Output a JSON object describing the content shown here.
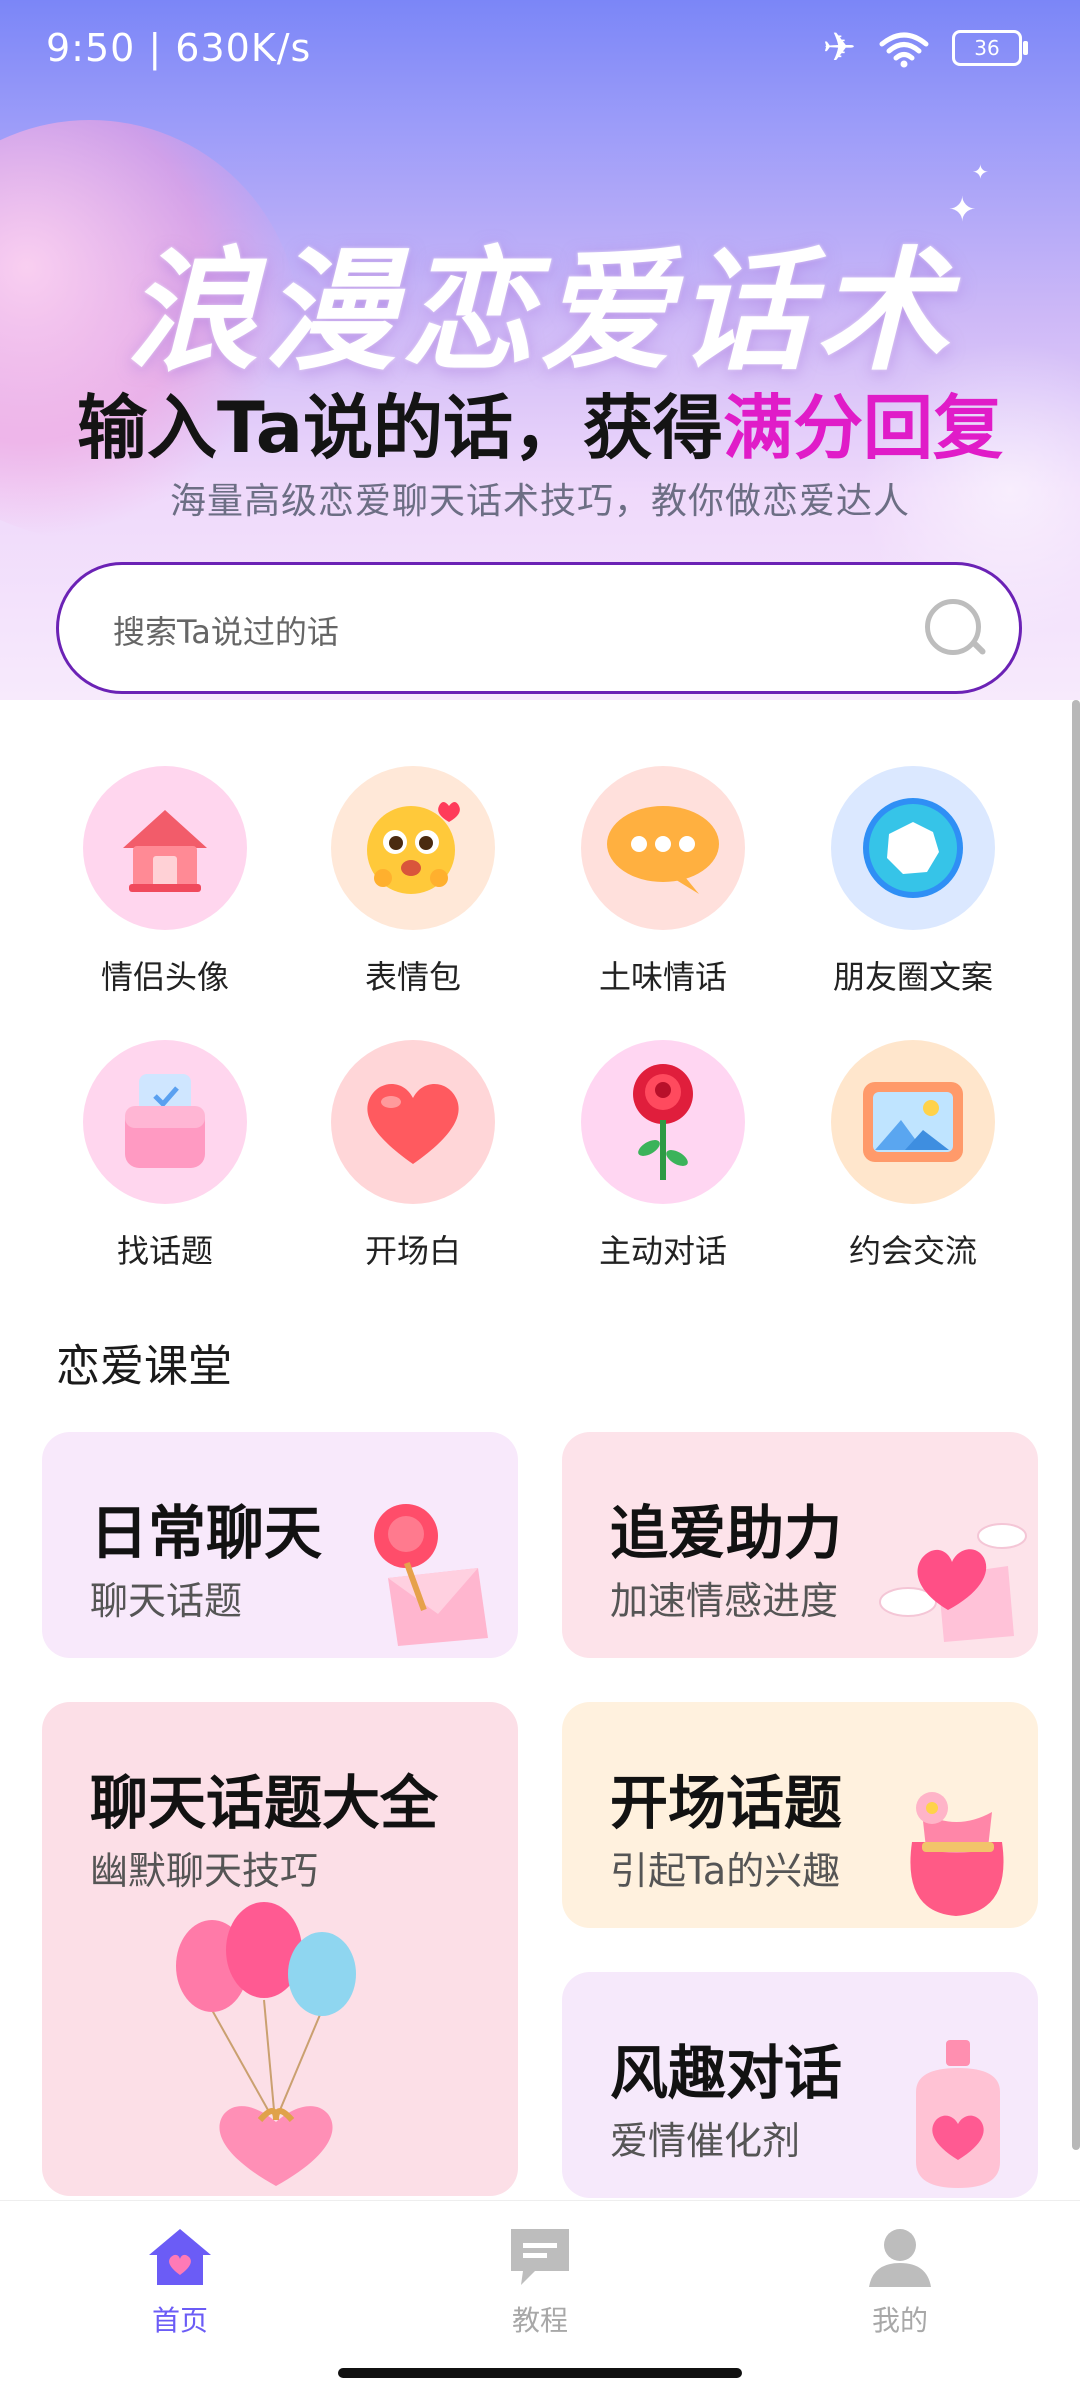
{
  "status_bar": {
    "time": "9:50 | 630K/s",
    "battery": "36"
  },
  "hero": {
    "title": "浪漫恋爱话术",
    "subtitle_main": "输入Ta说的话，获得",
    "subtitle_highlight": "满分回复",
    "description": "海量高级恋爱聊天话术技巧，教你做恋爱达人"
  },
  "search": {
    "placeholder": "搜索Ta说过的话"
  },
  "features": [
    {
      "label": "情侣头像",
      "icon": "house-icon"
    },
    {
      "label": "表情包",
      "icon": "emoji-icon"
    },
    {
      "label": "土味情话",
      "icon": "chat-bubble-icon"
    },
    {
      "label": "朋友圈文案",
      "icon": "aperture-icon"
    },
    {
      "label": "找话题",
      "icon": "pocket-icon"
    },
    {
      "label": "开场白",
      "icon": "heart-icon"
    },
    {
      "label": "主动对话",
      "icon": "rose-icon"
    },
    {
      "label": "约会交流",
      "icon": "picture-icon"
    }
  ],
  "section": {
    "title": "恋爱课堂"
  },
  "cards": [
    {
      "title": "日常聊天",
      "subtitle": "聊天话题"
    },
    {
      "title": "追爱助力",
      "subtitle": "加速情感进度"
    },
    {
      "title": "聊天话题大全",
      "subtitle": "幽默聊天技巧"
    },
    {
      "title": "开场话题",
      "subtitle": "引起Ta的兴趣"
    },
    {
      "title": "风趣对话",
      "subtitle": "爱情催化剂"
    }
  ],
  "nav": {
    "items": [
      {
        "label": "首页",
        "icon": "home-icon",
        "active": true
      },
      {
        "label": "教程",
        "icon": "message-icon",
        "active": false
      },
      {
        "label": "我的",
        "icon": "person-icon",
        "active": false
      }
    ]
  },
  "colors": {
    "accent": "#6b5cf6",
    "highlight": "#e01cc8",
    "search_border": "#6b22b5"
  }
}
